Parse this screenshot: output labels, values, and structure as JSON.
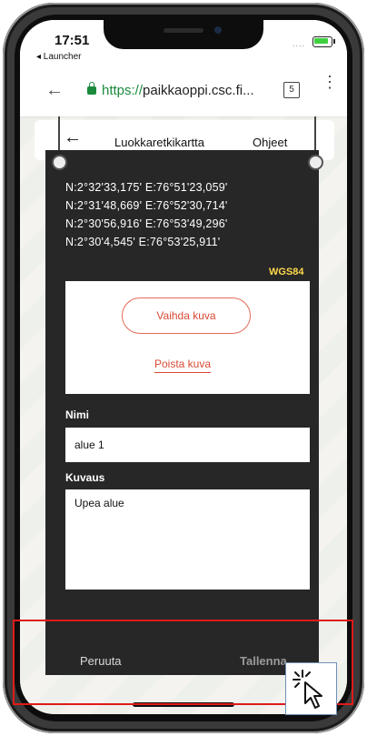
{
  "status_bar": {
    "time": "17:51",
    "back_to_app": "◂ Launcher",
    "signal": "....",
    "battery_color": "#3ed13e"
  },
  "browser": {
    "url_scheme": "https://",
    "url_host": "paikkaoppi.csc.fi...",
    "tabs_count": "5"
  },
  "app_header": {
    "title": "Luokkaretkikartta",
    "help": "Ohjeet"
  },
  "panel": {
    "coordinates": [
      "N:2°32'33,175' E:76°51'23,059'",
      "N:2°31'48,669' E:76°52'30,714'",
      "N:2°30'56,916' E:76°53'49,296'",
      "N:2°30'4,545' E:76°53'25,911'"
    ],
    "coord_system": "WGS84",
    "change_image_label": "Vaihda kuva",
    "remove_image_label": "Poista kuva",
    "name_label": "Nimi",
    "name_value": "alue 1",
    "description_label": "Kuvaus",
    "description_value": "Upea alue",
    "cancel_label": "Peruuta",
    "save_label": "Tallenna"
  },
  "colors": {
    "accent": "#d94a36",
    "highlight": "#e01a1a",
    "panel": "#272727",
    "wgs_label": "#ffd84a"
  }
}
